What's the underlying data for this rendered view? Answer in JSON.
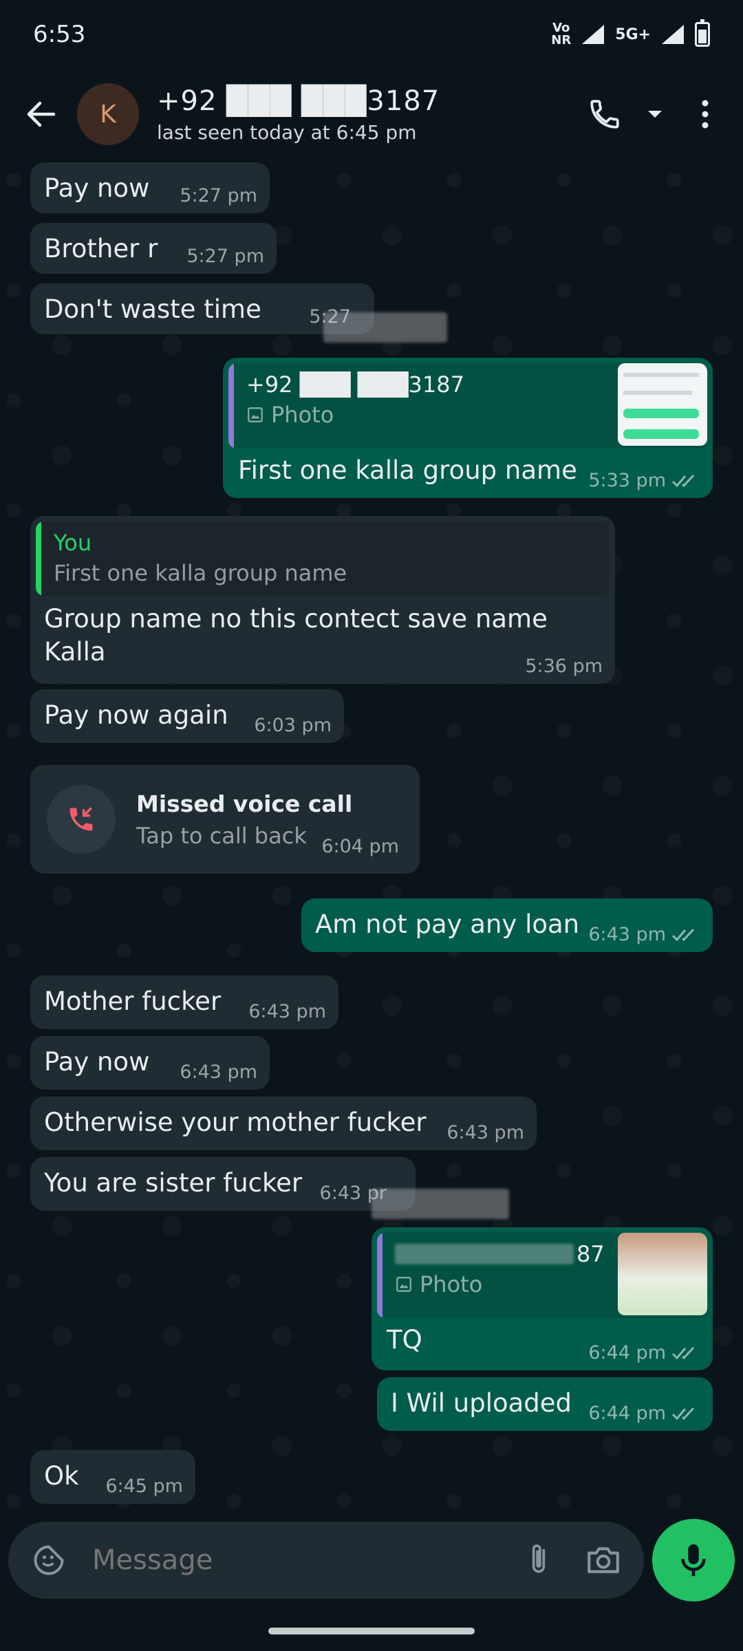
{
  "status_bar": {
    "time": "6:53",
    "network_top": "Vo",
    "network_bottom": "NR",
    "cellular": "5G+"
  },
  "header": {
    "avatar_initial": "K",
    "contact_name": "+92 ███ ███3187",
    "last_seen": "last seen today at 6:45 pm"
  },
  "messages": [
    {
      "text": "Pay now",
      "time": "5:27 pm",
      "direction": "in"
    },
    {
      "text": "Brother r",
      "time": "5:27 pm",
      "direction": "in"
    },
    {
      "text": "Don't waste time",
      "time": "5:27",
      "direction": "in"
    },
    {
      "quote_sender": "+92 ███ ███3187",
      "quote_type": "Photo",
      "text": "First one kalla group name",
      "time": "5:33 pm",
      "direction": "out",
      "status": "read"
    },
    {
      "quote_sender": "You",
      "quote_text": "First one kalla group name",
      "text": "Group name no this contect save name Kalla",
      "time": "5:36 pm",
      "direction": "in"
    },
    {
      "text": "Pay now again",
      "time": "6:03 pm",
      "direction": "in"
    },
    {
      "text": "Am not pay any loan",
      "time": "6:43 pm",
      "direction": "out",
      "status": "read"
    },
    {
      "text": "Mother fucker",
      "time": "6:43 pm",
      "direction": "in"
    },
    {
      "text": "Pay now",
      "time": "6:43 pm",
      "direction": "in"
    },
    {
      "text": "Otherwise your mother fucker",
      "time": "6:43 pm",
      "direction": "in"
    },
    {
      "text": "You are sister fucker",
      "time": "6:43 pr",
      "direction": "in"
    },
    {
      "quote_sender": "87",
      "quote_type": "Photo",
      "text": "TQ",
      "time": "6:44 pm",
      "direction": "out",
      "status": "read"
    },
    {
      "text": "I Wil uploaded",
      "time": "6:44 pm",
      "direction": "out",
      "status": "read"
    },
    {
      "text": "Ok",
      "time": "6:45 pm",
      "direction": "in"
    }
  ],
  "missed_call": {
    "title": "Missed voice call",
    "subtitle": "Tap to call back",
    "time": "6:04 pm"
  },
  "input": {
    "placeholder": "Message"
  },
  "colors": {
    "background": "#0b141a",
    "incoming_bubble": "#1f2c34",
    "outgoing_bubble": "#005c4b",
    "accent_green": "#21c063",
    "missed_call_red": "#f15c6d",
    "quote_purple": "#8d7bd9",
    "quote_green": "#25d366"
  },
  "icons": [
    "back-arrow-icon",
    "phone-icon",
    "dropdown-icon",
    "more-vert-icon",
    "photo-icon",
    "double-check-icon",
    "missed-call-icon",
    "sticker-icon",
    "attach-icon",
    "camera-icon",
    "mic-icon"
  ]
}
